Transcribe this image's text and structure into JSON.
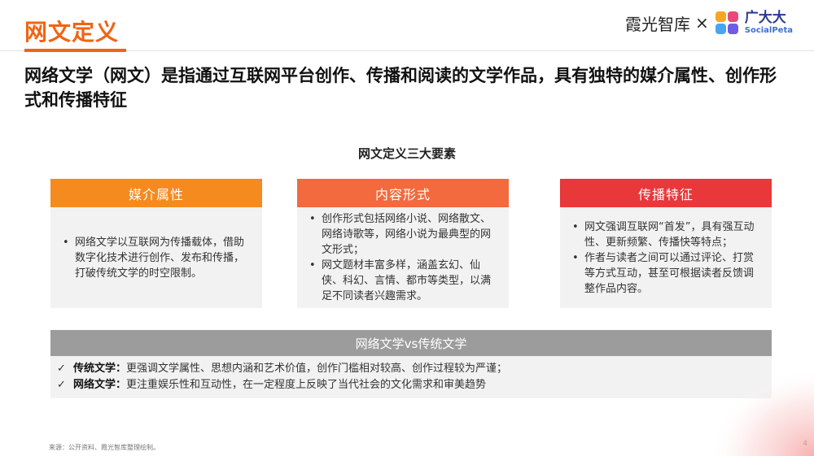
{
  "header": {
    "title": "网文定义",
    "brand_text": "霞光智库",
    "brand_x": "×",
    "partner_cn": "广大大",
    "partner_en": "SocialPeta"
  },
  "headline": "网络文学（网文）是指通过互联网平台创作、传播和阅读的文学作品，具有独特的媒介属性、创作形式和传播特征",
  "section_title": "网文定义三大要素",
  "cards": [
    {
      "title": "媒介属性",
      "color": "#f58a1f",
      "items": [
        "网络文学以互联网为传播载体，借助数字化技术进行创作、发布和传播，打破传统文学的时空限制。"
      ]
    },
    {
      "title": "内容形式",
      "color": "#f26a3d",
      "items": [
        "创作形式包括网络小说、网络散文、网络诗歌等，网络小说为最典型的网文形式；",
        "网文题材丰富多样，涵盖玄幻、仙侠、科幻、言情、都市等类型，以满足不同读者兴趣需求。"
      ]
    },
    {
      "title": "传播特征",
      "color": "#e8383a",
      "items": [
        "网文强调互联网“首发”，具有强互动性、更新频繁、传播快等特点；",
        "作者与读者之间可以通过评论、打赏等方式互动，甚至可根据读者反馈调整作品内容。"
      ]
    }
  ],
  "comparison": {
    "title": "网络文学vs传统文学",
    "rows": [
      {
        "label": "传统文学：",
        "text": "更强调文学属性、思想内涵和艺术价值，创作门槛相对较高、创作过程较为严谨；"
      },
      {
        "label": "网络文学：",
        "text": "更注重娱乐性和互动性，在一定程度上反映了当代社会的文化需求和审美趋势"
      }
    ],
    "check_glyph": "✓"
  },
  "footer": {
    "source": "来源：公开资料、霞光智库整理绘制。",
    "page_number": "4"
  },
  "colors": {
    "accent": "#f06414",
    "compare_header": "#9c9c9c"
  },
  "icons": {
    "partner_logo": "socialpeta-logo-icon",
    "check": "check-icon"
  }
}
